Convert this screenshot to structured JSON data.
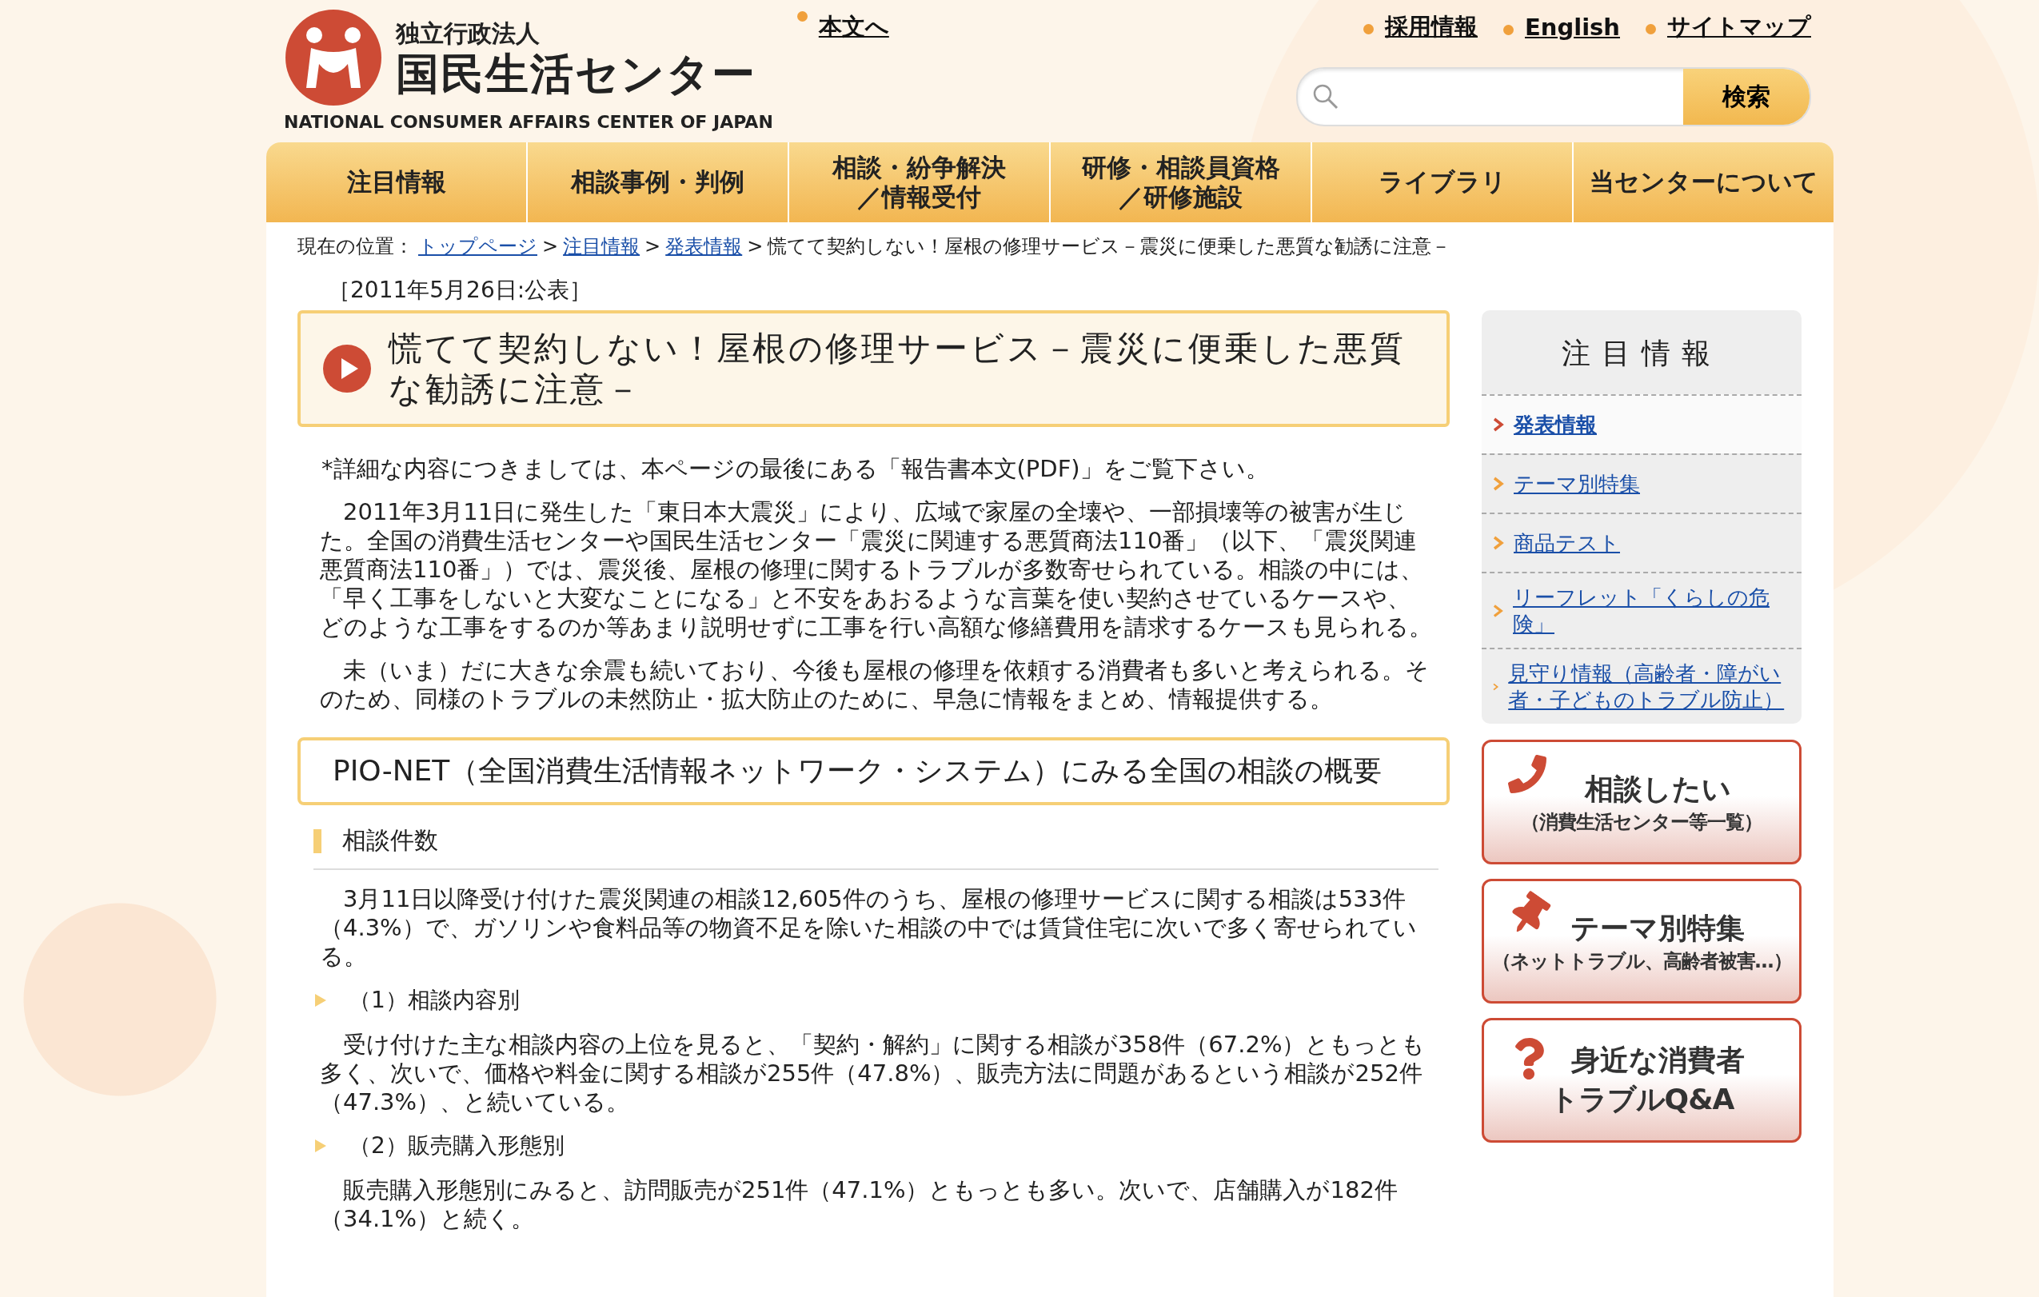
{
  "header": {
    "logo_small": "独立行政法人",
    "logo_main": "国民生活センター",
    "logo_english": "NATIONAL CONSUMER AFFAIRS CENTER OF JAPAN",
    "skip_link": "本文へ",
    "utility_links": [
      "採用情報",
      "English",
      "サイトマップ"
    ],
    "search_button": "検索"
  },
  "nav": [
    {
      "lines": [
        "注目情報"
      ]
    },
    {
      "lines": [
        "相談事例・判例"
      ]
    },
    {
      "lines": [
        "相談・紛争解決",
        "／情報受付"
      ]
    },
    {
      "lines": [
        "研修・相談員資格",
        "／研修施設"
      ]
    },
    {
      "lines": [
        "ライブラリ"
      ]
    },
    {
      "lines": [
        "当センターについて"
      ]
    }
  ],
  "breadcrumb": [
    {
      "kind": "label",
      "text": "現在の位置："
    },
    {
      "kind": "link",
      "text": "トップページ"
    },
    {
      "kind": "separator",
      "text": ">"
    },
    {
      "kind": "link",
      "text": "注目情報"
    },
    {
      "kind": "separator",
      "text": ">"
    },
    {
      "kind": "link",
      "text": "発表情報"
    },
    {
      "kind": "separator",
      "text": ">"
    },
    {
      "kind": "current",
      "text": "慌てて契約しない！屋根の修理サービス－震災に便乗した悪質な勧誘に注意－"
    }
  ],
  "article": {
    "date": "［2011年5月26日:公表］",
    "title": "慌てて契約しない！屋根の修理サービス－震災に便乗した悪質な勧誘に注意－",
    "blocks": [
      {
        "kind": "note",
        "text": "*詳細な内容につきましては、本ページの最後にある「報告書本文(PDF)」をご覧下さい。"
      },
      {
        "kind": "paragraph",
        "text": "2011年3月11日に発生した「東日本大震災」により、広域で家屋の全壊や、一部損壊等の被害が生じた。全国の消費生活センターや国民生活センター「震災に関連する悪質商法110番」（以下、「震災関連悪質商法110番」）では、震災後、屋根の修理に関するトラブルが多数寄せられている。相談の中には、「早く工事をしないと大変なことになる」と不安をあおるような言葉を使い契約させているケースや、どのような工事をするのか等あまり説明せずに工事を行い高額な修繕費用を請求するケースも見られる。"
      },
      {
        "kind": "paragraph",
        "text": "未（いま）だに大きな余震も続いており、今後も屋根の修理を依頼する消費者も多いと考えられる。そのため、同様のトラブルの未然防止・拡大防止のために、早急に情報をまとめ、情報提供する。"
      },
      {
        "kind": "section",
        "text": "PIO-NET（全国消費生活情報ネットワーク・システム）にみる全国の相談の概要"
      },
      {
        "kind": "heading",
        "text": "相談件数"
      },
      {
        "kind": "paragraph",
        "text": "3月11日以降受け付けた震災関連の相談12,605件のうち、屋根の修理サービスに関する相談は533件（4.3%）で、ガソリンや食料品等の物資不足を除いた相談の中では賃貸住宅に次いで多く寄せられている。"
      },
      {
        "kind": "subheading",
        "text": "（1）相談内容別"
      },
      {
        "kind": "paragraph",
        "text": "受け付けた主な相談内容の上位を見ると、「契約・解約」に関する相談が358件（67.2%）ともっとも多く、次いで、価格や料金に関する相談が255件（47.8%）、販売方法に問題があるという相談が252件（47.3%）、と続いている。"
      },
      {
        "kind": "subheading",
        "text": "（2）販売購入形態別"
      },
      {
        "kind": "paragraph",
        "text": "販売購入形態別にみると、訪問販売が251件（47.1%）ともっとも多い。次いで、店舗購入が182件（34.1%）と続く。"
      }
    ]
  },
  "sidebar": {
    "title": "注目情報",
    "items": [
      {
        "label": "発表情報",
        "selected": true
      },
      {
        "label": "テーマ別特集",
        "selected": false
      },
      {
        "label": "商品テスト",
        "selected": false
      },
      {
        "label": "リーフレット「くらしの危険」",
        "selected": false
      },
      {
        "label": "見守り情報（高齢者・障がい者・子どものトラブル防止）",
        "selected": false
      }
    ],
    "banners": [
      {
        "kind": "phone",
        "title": "相談したい",
        "subtitle": "（消費生活センター等一覧）"
      },
      {
        "kind": "pin",
        "title": "テーマ別特集",
        "subtitle": "（ネットトラブル、高齢者被害…）"
      },
      {
        "kind": "question",
        "title": "身近な消費者",
        "subtitle": "トラブルQ&A"
      }
    ]
  }
}
